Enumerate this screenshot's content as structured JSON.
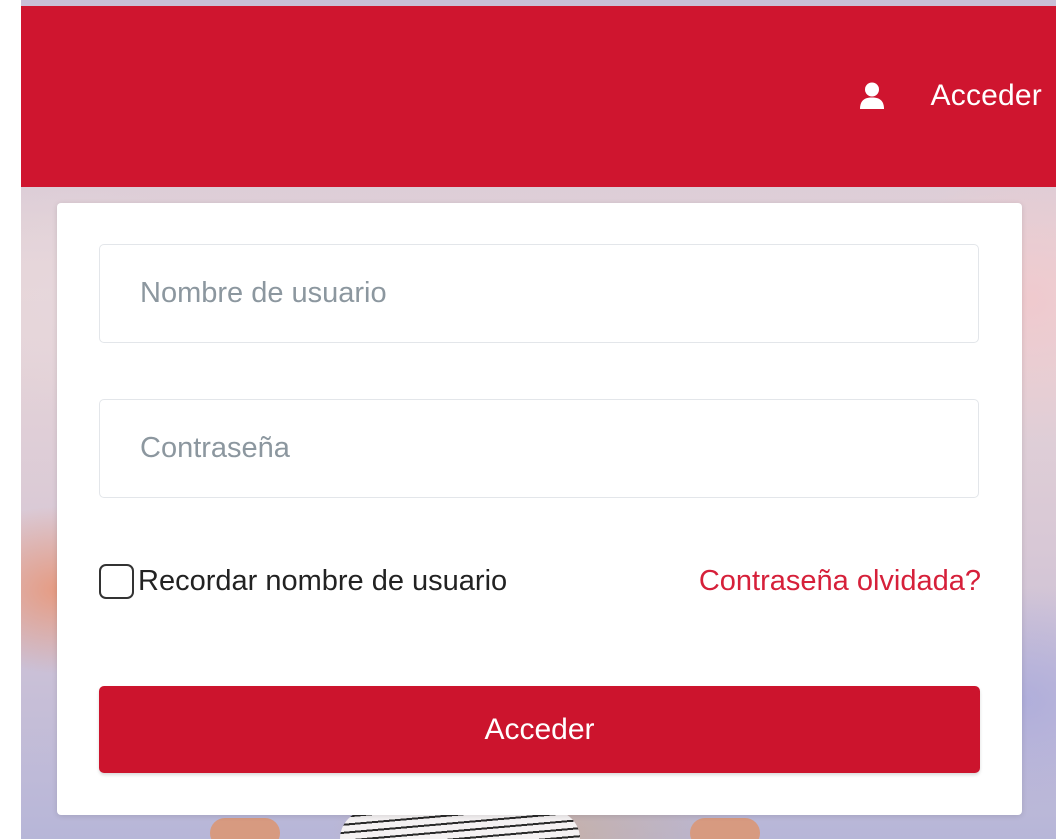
{
  "header": {
    "user_icon": "user-icon",
    "login_link_label": "Acceder"
  },
  "login_form": {
    "username_placeholder": "Nombre de usuario",
    "username_value": "",
    "password_placeholder": "Contraseña",
    "password_value": "",
    "remember_label": "Recordar nombre de usuario",
    "remember_checked": false,
    "forgot_password_label": "Contraseña olvidada?",
    "submit_label": "Acceder"
  },
  "colors": {
    "brand_red": "#cf152f",
    "link_red": "#d6203a",
    "placeholder_gray": "#8c979f"
  }
}
